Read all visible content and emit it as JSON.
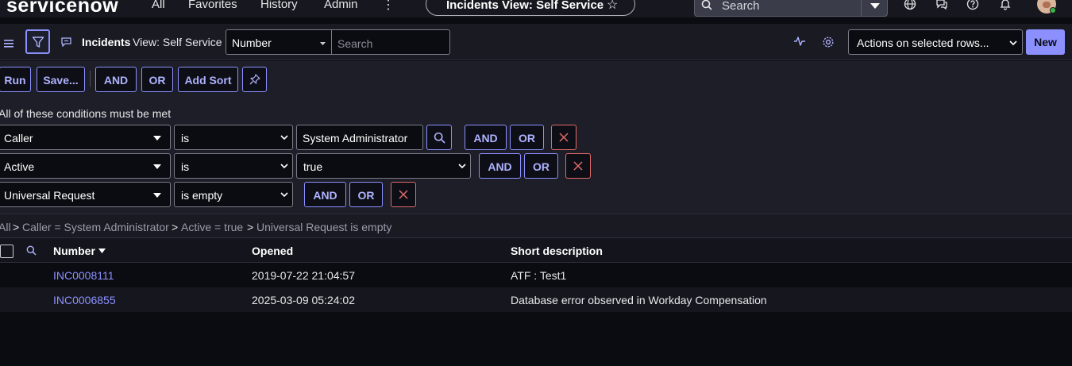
{
  "topnav": {
    "logo": "servicenow",
    "items": [
      "All",
      "Favorites",
      "History",
      "Admin"
    ],
    "more_icon": "more-vertical-icon",
    "context_pill": "Incidents View: Self Service",
    "search_placeholder": "Search",
    "icons": [
      "globe-icon",
      "chat-icon",
      "help-icon",
      "bell-icon"
    ]
  },
  "listbar": {
    "title": "Incidents",
    "view": "View: Self Service",
    "field_select": "Number",
    "search_placeholder": "Search",
    "actions_select": "Actions on selected rows...",
    "new_label": "New"
  },
  "toolbar": {
    "run": "Run",
    "save": "Save...",
    "and": "AND",
    "or": "OR",
    "add_sort": "Add Sort"
  },
  "conditions": {
    "title": "All of these conditions must be met",
    "rows": [
      {
        "field": "Caller",
        "operator": "is",
        "value": "System Administrator",
        "and": "AND",
        "or": "OR"
      },
      {
        "field": "Active",
        "operator": "is",
        "value": "true",
        "and": "AND",
        "or": "OR"
      },
      {
        "field": "Universal Request",
        "operator": "is empty",
        "value": "",
        "and": "AND",
        "or": "OR"
      }
    ]
  },
  "breadcrumbs": {
    "sep": ">",
    "items": [
      "All",
      "Caller = System Administrator",
      "Active = true",
      "Universal Request is empty"
    ]
  },
  "table": {
    "columns": [
      "Number",
      "Opened",
      "Short description"
    ],
    "rows": [
      {
        "number": "INC0008111",
        "opened": "2019-07-22 21:04:57",
        "short_description": "ATF : Test1"
      },
      {
        "number": "INC0006855",
        "opened": "2025-03-09 05:24:02",
        "short_description": "Database error observed in Workday Compensation"
      }
    ]
  },
  "colors": {
    "accent": "#8c90ff",
    "danger": "#e06a6a",
    "background": "#0b0c11"
  }
}
